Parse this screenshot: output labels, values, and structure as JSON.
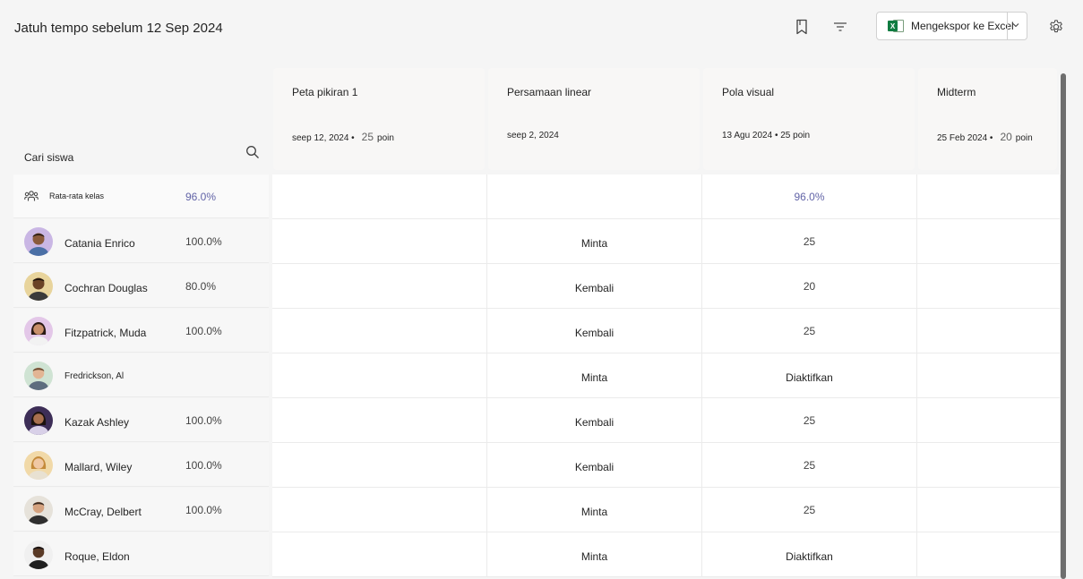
{
  "header": {
    "title": "Jatuh tempo sebelum 12 Sep 2024",
    "export_label": "Mengekspor ke Excel",
    "export_badge": "X"
  },
  "search": {
    "label": "Cari siswa"
  },
  "assignments": [
    {
      "name": "Peta pikiran 1",
      "date": "seep 12, 2024 •",
      "points": "25",
      "points_unit": "poin"
    },
    {
      "name": "Persamaan linear",
      "date": "seep 2, 2024",
      "points": "",
      "points_unit": ""
    },
    {
      "name": "Pola visual",
      "date": "13 Agu 2024 • 25 poin",
      "points": "",
      "points_unit": ""
    },
    {
      "name": "Midterm",
      "date": "25 Feb 2024 •",
      "points": "20",
      "points_unit": "poin"
    }
  ],
  "class_average": {
    "label": "Rata-rata kelas",
    "value": "96.0%",
    "cells": [
      "",
      "",
      "96.0%",
      ""
    ]
  },
  "students": [
    {
      "name": "Catania Enrico",
      "score": "100.0%",
      "cells": [
        "",
        "Minta",
        "25",
        ""
      ]
    },
    {
      "name": "Cochran Douglas",
      "score": "80.0%",
      "cells": [
        "",
        "Kembali",
        "20",
        ""
      ]
    },
    {
      "name": "Fitzpatrick, Muda",
      "score": "100.0%",
      "cells": [
        "",
        "Kembali",
        "25",
        ""
      ]
    },
    {
      "name": "Fredrickson, Al",
      "score": "",
      "cells": [
        "",
        "Minta",
        "Diaktifkan",
        ""
      ]
    },
    {
      "name": "Kazak Ashley",
      "score": "100.0%",
      "cells": [
        "",
        "Kembali",
        "25",
        ""
      ]
    },
    {
      "name": "Mallard, Wiley",
      "score": "100.0%",
      "cells": [
        "",
        "Kembali",
        "25",
        ""
      ]
    },
    {
      "name": "McCray, Delbert",
      "score": "100.0%",
      "cells": [
        "",
        "Minta",
        "25",
        ""
      ]
    },
    {
      "name": "Roque, Eldon",
      "score": "",
      "cells": [
        "",
        "Minta",
        "Diaktifkan",
        ""
      ]
    }
  ],
  "colors": {
    "accent": "#6264a7",
    "excel": "#107c41"
  },
  "icons": [
    "bookmark-icon",
    "filter-icon",
    "excel-icon",
    "chevron-down-icon",
    "gear-icon",
    "search-icon",
    "group-icon",
    "avatar"
  ]
}
